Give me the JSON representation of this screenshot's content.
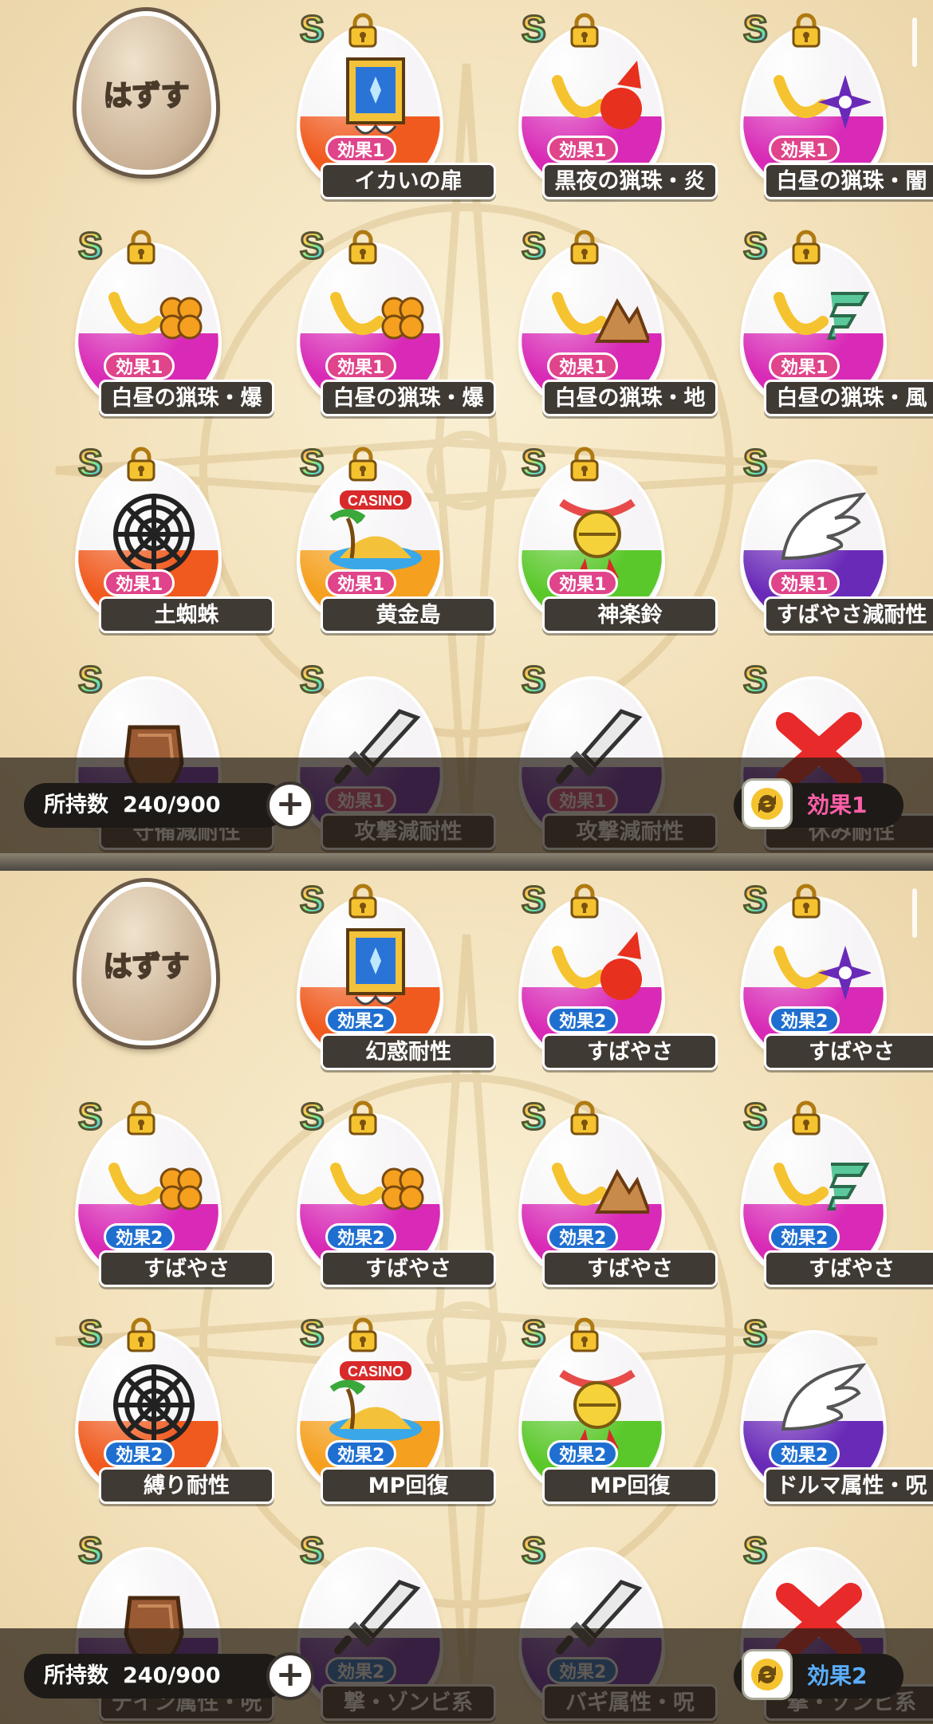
{
  "colors": {
    "effect1": "#e0448a",
    "effect2": "#1f6fd0"
  },
  "panels": [
    {
      "unequip_label": "はずす",
      "count_label": "所持数",
      "count_value": "240/900",
      "plus_label": "+",
      "current_effect": "効果1",
      "items": [
        {
          "rank": "S",
          "locked": true,
          "icon": "ika-door-icon",
          "color": "#f05a1e",
          "effect": "効果1",
          "name": "イカいの扉"
        },
        {
          "rank": "S",
          "locked": true,
          "icon": "horn-fire-icon",
          "color": "#d82ab6",
          "effect": "効果1",
          "name": "黒夜の猟珠・炎"
        },
        {
          "rank": "S",
          "locked": true,
          "icon": "horn-dark-icon",
          "color": "#d82ab6",
          "effect": "効果1",
          "name": "白昼の猟珠・闇"
        },
        {
          "rank": "S",
          "locked": true,
          "icon": "horn-blast-icon",
          "color": "#d82ab6",
          "effect": "効果1",
          "name": "白昼の猟珠・爆"
        },
        {
          "rank": "S",
          "locked": true,
          "icon": "horn-blast-icon",
          "color": "#d82ab6",
          "effect": "効果1",
          "name": "白昼の猟珠・爆"
        },
        {
          "rank": "S",
          "locked": true,
          "icon": "horn-earth-icon",
          "color": "#d82ab6",
          "effect": "効果1",
          "name": "白昼の猟珠・地"
        },
        {
          "rank": "S",
          "locked": true,
          "icon": "horn-wind-icon",
          "color": "#d82ab6",
          "effect": "効果1",
          "name": "白昼の猟珠・風"
        },
        {
          "rank": "S",
          "locked": true,
          "icon": "spider-web-icon",
          "color": "#f05a1e",
          "effect": "効果1",
          "name": "土蜘蛛"
        },
        {
          "rank": "S",
          "locked": true,
          "icon": "casino-island-icon",
          "color": "#f5a01e",
          "effect": "効果1",
          "name": "黄金島"
        },
        {
          "rank": "S",
          "locked": true,
          "icon": "kagura-bell-icon",
          "color": "#5ac82a",
          "effect": "効果1",
          "name": "神楽鈴"
        },
        {
          "rank": "S",
          "locked": false,
          "icon": "wing-icon",
          "color": "#6a2ab8",
          "effect": "効果1",
          "name": "すばやさ減耐性"
        },
        {
          "rank": "S",
          "locked": false,
          "icon": "shield-icon",
          "color": "#6a2ab8",
          "effect": "効果1",
          "name": "守備減耐性"
        },
        {
          "rank": "S",
          "locked": false,
          "icon": "sword-icon",
          "color": "#6a2ab8",
          "effect": "効果1",
          "name": "攻撃減耐性"
        },
        {
          "rank": "S",
          "locked": false,
          "icon": "sword-icon",
          "color": "#6a2ab8",
          "effect": "効果1",
          "name": "攻撃減耐性"
        },
        {
          "rank": "S",
          "locked": false,
          "icon": "cross-icon",
          "color": "#6a2ab8",
          "effect": "効果1",
          "name": "休み耐性"
        }
      ]
    },
    {
      "unequip_label": "はずす",
      "count_label": "所持数",
      "count_value": "240/900",
      "plus_label": "+",
      "current_effect": "効果2",
      "items": [
        {
          "rank": "S",
          "locked": true,
          "icon": "ika-door-icon",
          "color": "#f05a1e",
          "effect": "効果2",
          "name": "幻惑耐性"
        },
        {
          "rank": "S",
          "locked": true,
          "icon": "horn-fire-icon",
          "color": "#d82ab6",
          "effect": "効果2",
          "name": "すばやさ"
        },
        {
          "rank": "S",
          "locked": true,
          "icon": "horn-dark-icon",
          "color": "#d82ab6",
          "effect": "効果2",
          "name": "すばやさ"
        },
        {
          "rank": "S",
          "locked": true,
          "icon": "horn-blast-icon",
          "color": "#d82ab6",
          "effect": "効果2",
          "name": "すばやさ"
        },
        {
          "rank": "S",
          "locked": true,
          "icon": "horn-blast-icon",
          "color": "#d82ab6",
          "effect": "効果2",
          "name": "すばやさ"
        },
        {
          "rank": "S",
          "locked": true,
          "icon": "horn-earth-icon",
          "color": "#d82ab6",
          "effect": "効果2",
          "name": "すばやさ"
        },
        {
          "rank": "S",
          "locked": true,
          "icon": "horn-wind-icon",
          "color": "#d82ab6",
          "effect": "効果2",
          "name": "すばやさ"
        },
        {
          "rank": "S",
          "locked": true,
          "icon": "spider-web-icon",
          "color": "#f05a1e",
          "effect": "効果2",
          "name": "縛り耐性"
        },
        {
          "rank": "S",
          "locked": true,
          "icon": "casino-island-icon",
          "color": "#f5a01e",
          "effect": "効果2",
          "name": "MP回復"
        },
        {
          "rank": "S",
          "locked": true,
          "icon": "kagura-bell-icon",
          "color": "#5ac82a",
          "effect": "効果2",
          "name": "MP回復"
        },
        {
          "rank": "S",
          "locked": false,
          "icon": "wing-icon",
          "color": "#6a2ab8",
          "effect": "効果2",
          "name": "ドルマ属性・呪"
        },
        {
          "rank": "S",
          "locked": false,
          "icon": "shield-icon",
          "color": "#6a2ab8",
          "effect": "効果2",
          "name": "デイン属性・呪"
        },
        {
          "rank": "S",
          "locked": false,
          "icon": "sword-icon",
          "color": "#6a2ab8",
          "effect": "効果2",
          "name": "撃・ゾンビ系"
        },
        {
          "rank": "S",
          "locked": false,
          "icon": "sword-icon",
          "color": "#6a2ab8",
          "effect": "効果2",
          "name": "バギ属性・呪"
        },
        {
          "rank": "S",
          "locked": false,
          "icon": "cross-icon",
          "color": "#6a2ab8",
          "effect": "効果2",
          "name": "撃・ゾンビ系"
        }
      ]
    }
  ]
}
